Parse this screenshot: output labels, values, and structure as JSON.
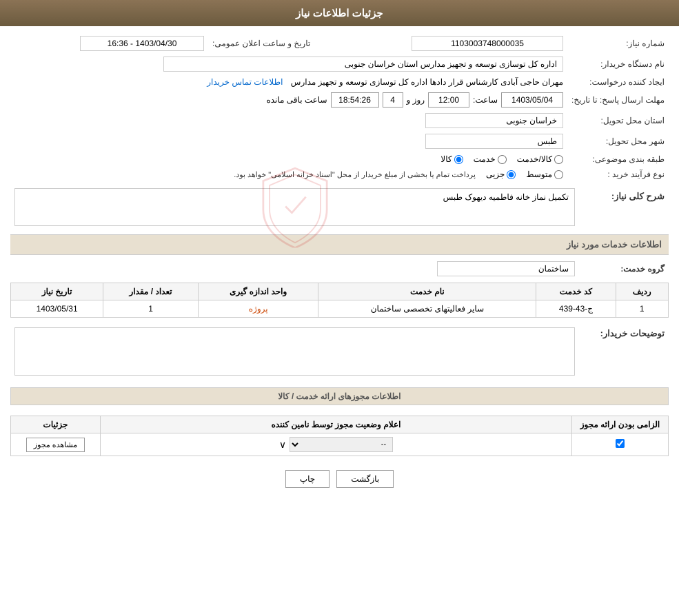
{
  "header": {
    "title": "جزئیات اطلاعات نیاز"
  },
  "fields": {
    "request_number_label": "شماره نیاز:",
    "request_number_value": "1103003748000035",
    "buyer_org_label": "نام دستگاه خریدار:",
    "buyer_org_value": "اداره کل توسازی  توسعه و تجهیز مدارس استان خراسان جنوبی",
    "requester_label": "ایجاد کننده درخواست:",
    "requester_value": "مهران حاجی آبادی کارشناس قرار دادها اداره کل توسازی  توسعه و تجهیز مدارس",
    "contact_info_link": "اطلاعات تماس خریدار",
    "send_deadline_label": "مهلت ارسال پاسخ: تا تاریخ:",
    "send_deadline_date": "1403/05/04",
    "send_deadline_time_label": "ساعت:",
    "send_deadline_time": "12:00",
    "send_deadline_days_label": "روز و",
    "send_deadline_days": "4",
    "send_deadline_remaining_label": "ساعت باقی مانده",
    "send_deadline_remaining": "18:54:26",
    "province_label": "استان محل تحویل:",
    "province_value": "خراسان جنوبی",
    "city_label": "شهر محل تحویل:",
    "city_value": "طبس",
    "category_label": "طبقه بندی موضوعی:",
    "category_kala": "کالا",
    "category_khedmat": "خدمت",
    "category_kala_khedmat": "کالا/خدمت",
    "purchase_type_label": "نوع فرآیند خرید :",
    "purchase_type_jozyi": "جزیی",
    "purchase_type_mottavaset": "متوسط",
    "purchase_type_desc": "پرداخت تمام یا بخشی از مبلغ خریدار از محل \"اسناد خزانه اسلامی\" خواهد بود.",
    "announce_time_label": "تاریخ و ساعت اعلان عمومی:",
    "announce_time_value": "1403/04/30 - 16:36",
    "description_label": "شرح کلی نیاز:",
    "description_value": "تکمیل نماز خانه فاطمیه دیهوک طبس",
    "services_section_title": "اطلاعات خدمات مورد نیاز",
    "service_group_label": "گروه خدمت:",
    "service_group_value": "ساختمان",
    "services_table": {
      "col_radif": "ردیف",
      "col_code": "کد خدمت",
      "col_name": "نام خدمت",
      "col_unit": "واحد اندازه گیری",
      "col_count": "تعداد / مقدار",
      "col_date": "تاریخ نیاز",
      "rows": [
        {
          "radif": "1",
          "code": "ج-43-439",
          "name": "سایر فعالیتهای تخصصی ساختمان",
          "unit": "پروژه",
          "count": "1",
          "date": "1403/05/31"
        }
      ]
    },
    "buyer_desc_label": "توضیحات خریدار:",
    "buyer_desc_value": ""
  },
  "permissions_section": {
    "title": "اطلاعات مجوزهای ارائه خدمت / کالا",
    "table": {
      "col_required": "الزامی بودن ارائه مجوز",
      "col_status": "اعلام وضعیت مجوز توسط نامین کننده",
      "col_details": "جزئیات",
      "rows": [
        {
          "required_checked": true,
          "status_value": "--",
          "details_btn": "مشاهده مجوز"
        }
      ]
    }
  },
  "footer": {
    "back_btn": "بازگشت",
    "print_btn": "چاپ"
  }
}
